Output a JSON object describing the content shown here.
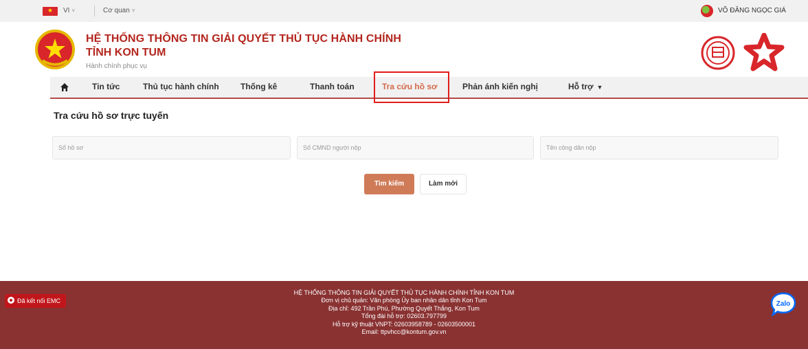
{
  "topbar": {
    "language": "VI",
    "agency": "Cơ quan",
    "username": "VÕ ĐĂNG NGỌC GIÁ"
  },
  "header": {
    "title_line1": "HỆ THỐNG THÔNG TIN GIẢI QUYẾT THỦ TỤC HÀNH CHÍNH",
    "title_line2": "TỈNH KON TUM",
    "slogan": "Hành chính phục vụ"
  },
  "nav": {
    "items": [
      {
        "label": "Tin tức"
      },
      {
        "label": "Thủ tục hành chính"
      },
      {
        "label": "Thống kê"
      },
      {
        "label": "Thanh toán"
      },
      {
        "label": "Tra cứu hồ sơ"
      },
      {
        "label": "Phản ánh kiến nghị"
      },
      {
        "label": "Hỗ trợ"
      }
    ],
    "active_index": 4
  },
  "search": {
    "title": "Tra cứu hồ sơ trực tuyến",
    "fields": [
      {
        "placeholder": "Số hồ sơ"
      },
      {
        "placeholder": "Số CMND người nộp"
      },
      {
        "placeholder": "Tên công dân nộp"
      }
    ],
    "search_button": "Tìm kiếm",
    "reset_button": "Làm mới"
  },
  "footer": {
    "badge": "Đã kết nối EMC",
    "lines": [
      "HỆ THỐNG THÔNG TIN GIẢI QUYẾT THỦ TỤC HÀNH CHÍNH TỈNH KON TUM",
      "Đơn vị chủ quản: Văn phòng Ủy ban nhân dân tỉnh Kon Tum",
      "Địa chỉ: 492 Trần Phú, Phường Quyết Thắng, Kon Tum",
      "Tổng đài hỗ trợ: 02603.797799",
      "Hỗ trợ kỹ thuật VNPT: 02603958789 - 02603500001",
      "Email: ttpvhcc@kontum.gov.vn"
    ],
    "zalo_label": "Zalo"
  },
  "colors": {
    "brand_red": "#b3261e",
    "active_orange": "#d26a4a",
    "footer_bg": "#8a3232",
    "button_bg": "#cf7b58"
  }
}
